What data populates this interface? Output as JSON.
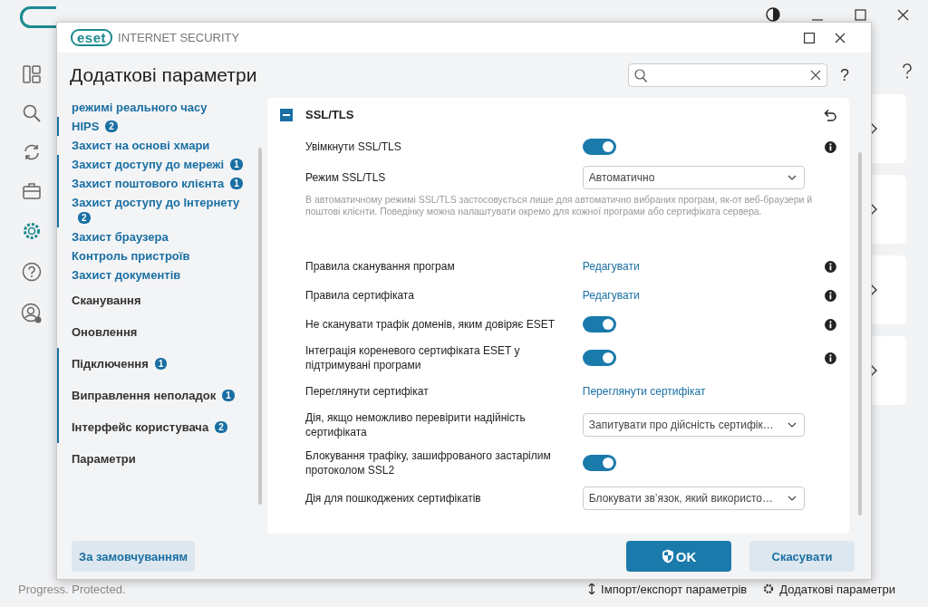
{
  "background": {
    "status": "Progress. Protected.",
    "footer_links": [
      {
        "kind": "import",
        "label": "Імпорт/експорт параметрів"
      },
      {
        "kind": "settings",
        "label": "Додаткові параметри"
      }
    ]
  },
  "dialog": {
    "logo": "eset",
    "product": "INTERNET SECURITY",
    "title": "Додаткові параметри",
    "help": "?",
    "sidebar": [
      {
        "kind": "sub",
        "label": "режимі реального часу",
        "modified": false
      },
      {
        "kind": "sub",
        "label": "HIPS",
        "badge": "2",
        "modified": true
      },
      {
        "kind": "sub",
        "label": "Захист на основі хмари",
        "modified": false
      },
      {
        "kind": "sub",
        "label": "Захист доступу до мережі",
        "badge": "1",
        "modified": true
      },
      {
        "kind": "sub",
        "label": "Захист поштового клієнта",
        "badge": "1",
        "modified": true
      },
      {
        "kind": "sub",
        "label": "Захист доступу до Інтернету",
        "badge": "2",
        "modified": true
      },
      {
        "kind": "sub",
        "label": "Захист браузера",
        "modified": false
      },
      {
        "kind": "sub",
        "label": "Контроль пристроїв",
        "modified": false
      },
      {
        "kind": "sub",
        "label": "Захист документів",
        "modified": false
      },
      {
        "kind": "section",
        "label": "Сканування",
        "modified": false
      },
      {
        "kind": "section",
        "label": "Оновлення",
        "modified": false
      },
      {
        "kind": "section",
        "label": "Підключення",
        "badge": "1",
        "modified": true
      },
      {
        "kind": "section",
        "label": "Виправлення неполадок",
        "badge": "1",
        "modified": true
      },
      {
        "kind": "section",
        "label": "Інтерфейс користувача",
        "badge": "2",
        "modified": true
      },
      {
        "kind": "section",
        "label": "Параметри",
        "modified": false
      }
    ],
    "section": {
      "title": "SSL/TLS",
      "expanded": true,
      "rows": [
        {
          "kind": "toggle",
          "label": "Увімкнути SSL/TLS",
          "on": true,
          "info": true
        },
        {
          "kind": "select",
          "label": "Режим SSL/TLS",
          "value": "Автоматично",
          "info": false,
          "description": "В автоматичному режимі SSL/TLS застосовується лише для автоматично вибраних програм, як-от веб-браузери й поштові клієнти. Поведінку можна налаштувати окремо для кожної програми або сертифіката сервера."
        },
        {
          "kind": "link",
          "label": "Правила сканування програм",
          "value": "Редагувати",
          "info": true
        },
        {
          "kind": "link",
          "label": "Правила сертифіката",
          "value": "Редагувати",
          "info": true
        },
        {
          "kind": "toggle",
          "label": "Не сканувати трафік доменів, яким довіряє ESET",
          "on": true,
          "info": true
        },
        {
          "kind": "toggle",
          "label": "Інтеграція кореневого сертифіката ESET у підтримувані програми",
          "on": true,
          "info": true
        },
        {
          "kind": "link",
          "label": "Переглянути сертифікат",
          "value": "Переглянути сертифікат",
          "info": false
        },
        {
          "kind": "select",
          "label": "Дія, якщо неможливо перевірити надійність сертифіката",
          "value": "Запитувати про дійсність сертифік…",
          "info": false
        },
        {
          "kind": "toggle",
          "label": "Блокування трафіку, зашифрованого застарілим протоколом SSL2",
          "on": true,
          "info": false
        },
        {
          "kind": "select",
          "label": "Дія для пошкоджених сертифікатів",
          "value": "Блокувати зв’язок, який використо…",
          "info": false
        }
      ]
    },
    "buttons": [
      {
        "kind": "secondary",
        "label": "За замовчуванням"
      },
      {
        "kind": "primary",
        "label": "OK"
      },
      {
        "kind": "secondary",
        "label": "Скасувати"
      }
    ]
  }
}
